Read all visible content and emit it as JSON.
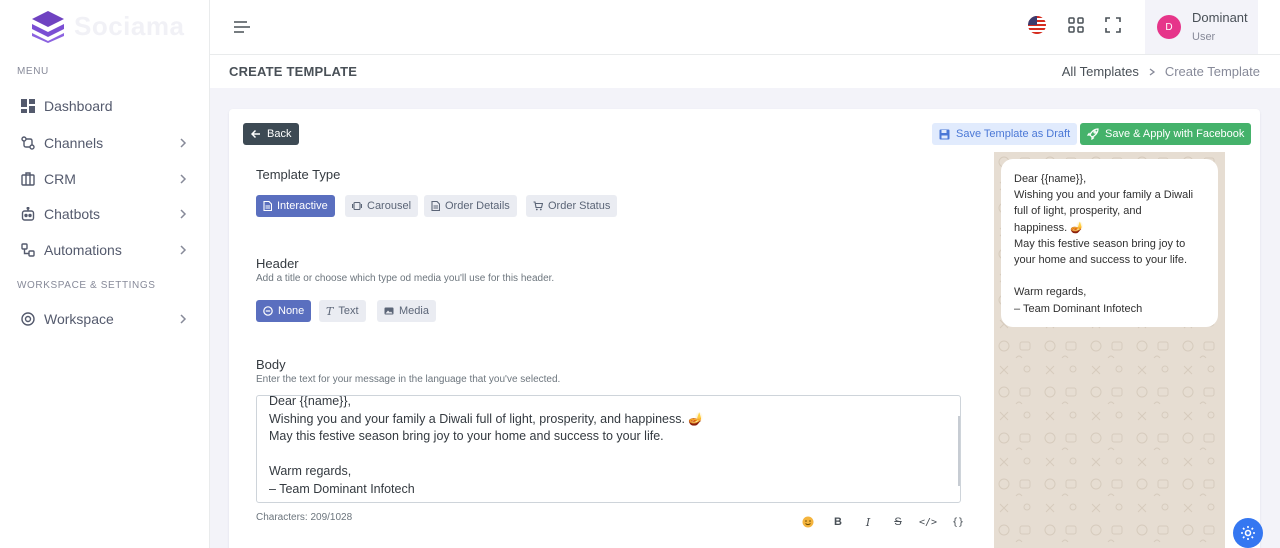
{
  "app": {
    "logo_text": "Sociama"
  },
  "sidebar": {
    "menu_title": "MENU",
    "items": [
      {
        "label": "Dashboard",
        "icon": "dashboard-icon"
      },
      {
        "label": "Channels",
        "icon": "channels-icon"
      },
      {
        "label": "CRM",
        "icon": "crm-icon"
      },
      {
        "label": "Chatbots",
        "icon": "chatbots-icon"
      },
      {
        "label": "Automations",
        "icon": "automations-icon"
      }
    ],
    "settings_title": "WORKSPACE & SETTINGS",
    "settings_items": [
      {
        "label": "Workspace",
        "icon": "workspace-icon"
      }
    ]
  },
  "topbar": {
    "user_initial": "D",
    "user_name": "Dominant",
    "user_role": "User"
  },
  "page": {
    "title": "CREATE TEMPLATE",
    "breadcrumb": [
      "All Templates",
      "Create Template"
    ]
  },
  "actions": {
    "back": "Back",
    "save_draft": "Save Template as Draft",
    "save_apply": "Save & Apply with Facebook"
  },
  "template_type": {
    "label": "Template Type",
    "options": [
      "Interactive",
      "Carousel",
      "Order Details",
      "Order Status"
    ],
    "selected": "Interactive"
  },
  "header": {
    "label": "Header",
    "description": "Add a title or choose which type od media you'll use for this header.",
    "options": [
      "None",
      "Text",
      "Media"
    ],
    "selected": "None"
  },
  "body": {
    "label": "Body",
    "description": "Enter the text for your message in the language that you've selected.",
    "lines": [
      "Dear {{name}},",
      "Wishing you and your family a Diwali full of light, prosperity, and happiness. 🪔",
      "May this festive season bring joy to your home and success to your life.",
      "",
      "Warm regards,",
      "– Team Dominant Infotech"
    ],
    "char_count": "Characters: 209/1028",
    "toolbar": [
      "emoji",
      "B",
      "I",
      "S",
      "</>",
      "{}"
    ]
  },
  "preview": {
    "lines": [
      "Dear {{name}},",
      "Wishing you and your family a Diwali",
      "full of light, prosperity, and",
      "happiness. 🪔",
      "May this festive season bring joy to",
      "your home and success to your life.",
      "",
      "Warm regards,",
      "– Team Dominant Infotech"
    ]
  },
  "colors": {
    "accent": "#5a6fbf",
    "success": "#45b26b",
    "dark": "#3d4a54",
    "avatar": "#e6358a",
    "fab": "#3577f1"
  }
}
